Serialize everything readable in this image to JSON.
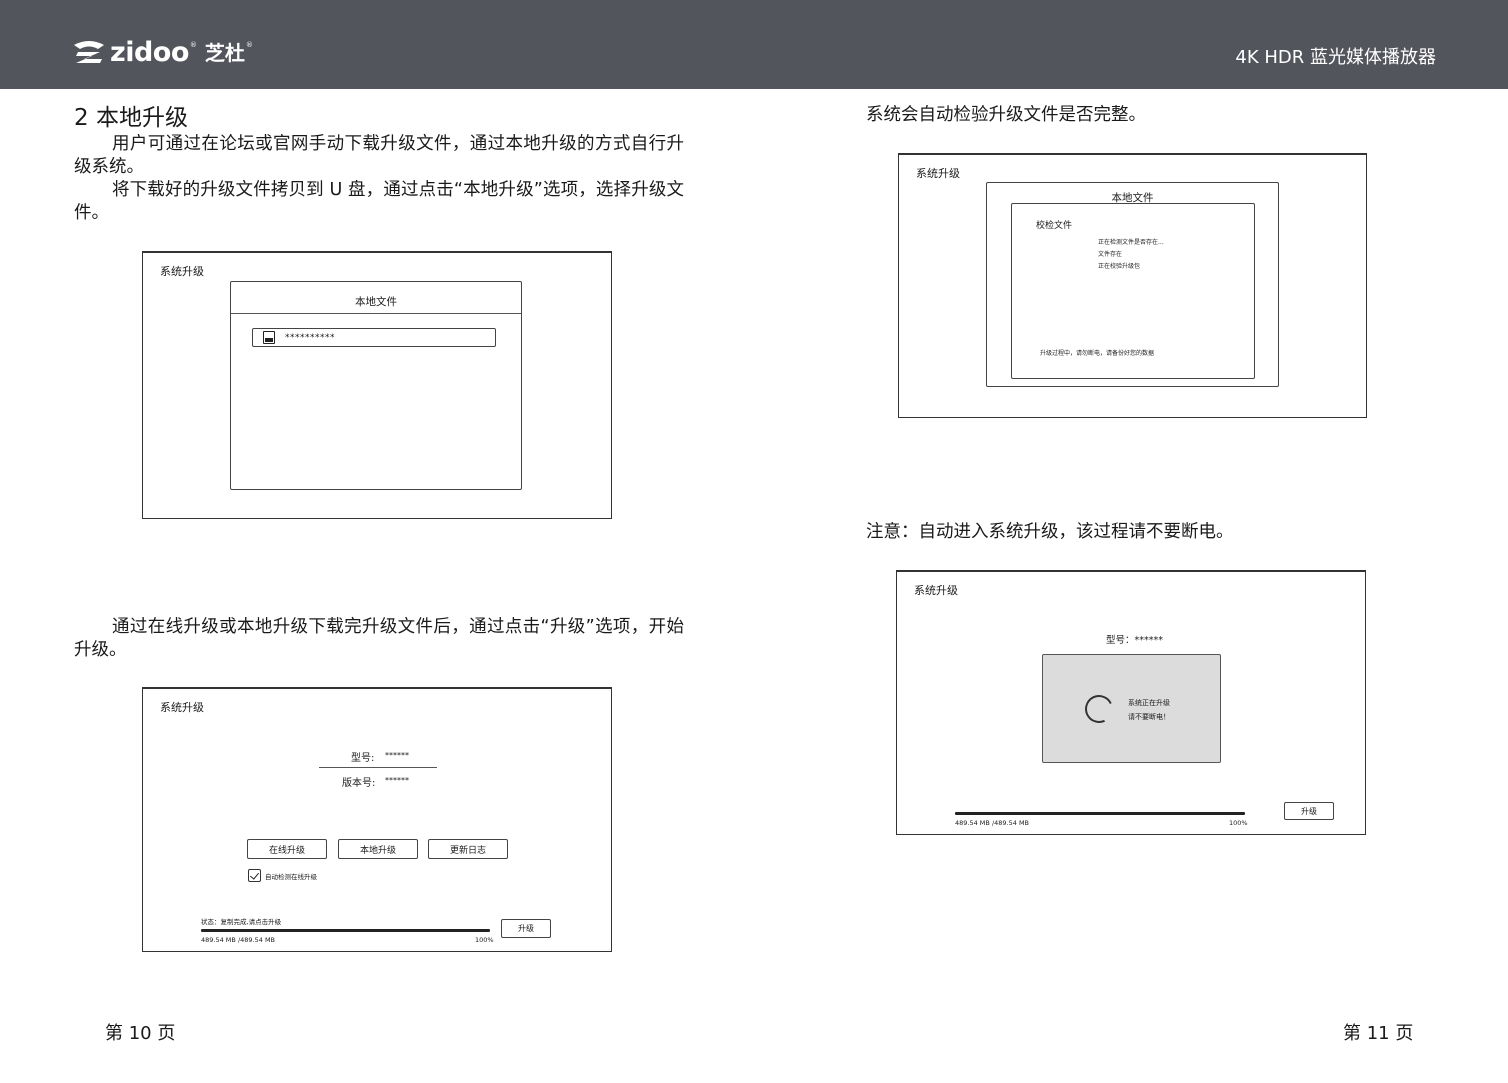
{
  "header": {
    "brand": "zidoo",
    "brand_cn": "芝杜",
    "reg_mark": "®",
    "product": "4K HDR 蓝光媒体播放器"
  },
  "left_page": {
    "section_title": "2 本地升级",
    "para1": "用户可通过在论坛或官网手动下载升级文件，通过本地升级的方式自行升级系统。",
    "para2": "将下载好的升级文件拷贝到 U 盘，通过点击“本地升级”选项，选择升级文件。",
    "para3": "通过在线升级或本地升级下载完升级文件后，通过点击“升级”选项，开始升级。",
    "page_number": "第 10 页",
    "screen1": {
      "title": "系统升级",
      "dialog_title": "本地文件",
      "file_name": "**********"
    },
    "screen2": {
      "title": "系统升级",
      "model_label": "型号:",
      "model_value": "******",
      "version_label": "版本号:",
      "version_value": "******",
      "buttons": [
        "在线升级",
        "本地升级",
        "更新日志"
      ],
      "auto_check_label": "自动检测在线升级",
      "status_text": "状态：复制完成,请点击升级",
      "size_text": "489.54 MB /489.54 MB",
      "percent_text": "100%",
      "progress": 1.0,
      "upgrade_button": "升级"
    }
  },
  "right_page": {
    "text1": "系统会自动检验升级文件是否完整。",
    "text2": "注意：自动进入系统升级，该过程请不要断电。",
    "page_number": "第 11 页",
    "screen3": {
      "title": "系统升级",
      "dialog_title": "本地文件",
      "inner_title": "校检文件",
      "lines": [
        "正在检测文件是否存在...",
        "文件存在",
        "正在校验升级包"
      ],
      "warning": "升级过程中，请勿断电，请备份好您的数据"
    },
    "screen4": {
      "title": "系统升级",
      "model_text": "型号：******",
      "upgrading_line1": "系统正在升级",
      "upgrading_line2": "请不要断电！",
      "size_text": "489.54 MB /489.54 MB",
      "percent_text": "100%",
      "progress": 1.0,
      "upgrade_button": "升级"
    }
  }
}
